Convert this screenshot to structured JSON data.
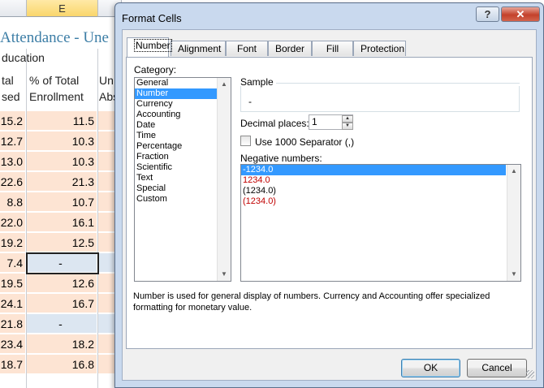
{
  "spreadsheet": {
    "column_letter": "E",
    "title": "Attendance - Une",
    "header_group": "ducation",
    "col_d_header": [
      "tal",
      "sed"
    ],
    "col_e_header": [
      "% of Total",
      "Enrollment"
    ],
    "col_f_header": [
      "Un",
      "Abs"
    ],
    "rows": [
      {
        "d": "15.2",
        "e": "11.5"
      },
      {
        "d": "12.7",
        "e": "10.3"
      },
      {
        "d": "13.0",
        "e": "10.3"
      },
      {
        "d": "22.6",
        "e": "21.3"
      },
      {
        "d": "8.8",
        "e": "10.7"
      },
      {
        "d": "22.0",
        "e": "16.1"
      },
      {
        "d": "19.2",
        "e": "12.5"
      },
      {
        "d": "7.4",
        "e": "-"
      },
      {
        "d": "19.5",
        "e": "12.6"
      },
      {
        "d": "24.1",
        "e": "16.7"
      },
      {
        "d": "21.8",
        "e": "-"
      },
      {
        "d": "23.4",
        "e": "18.2"
      },
      {
        "d": "18.7",
        "e": "16.8"
      }
    ]
  },
  "dialog": {
    "title": "Format Cells",
    "help_glyph": "?",
    "close_glyph": "X",
    "tabs": [
      "Number",
      "Alignment",
      "Font",
      "Border",
      "Fill",
      "Protection"
    ],
    "category_label": "Category:",
    "categories": [
      "General",
      "Number",
      "Currency",
      "Accounting",
      "Date",
      "Time",
      "Percentage",
      "Fraction",
      "Scientific",
      "Text",
      "Special",
      "Custom"
    ],
    "selected_category": "Number",
    "sample_label": "Sample",
    "sample_value": "-",
    "decimal_label": "Decimal places:",
    "decimal_value": "1",
    "separator_label": "Use 1000 Separator (,)",
    "separator_checked": false,
    "negative_label": "Negative numbers:",
    "negative_options": [
      {
        "text": "-1234.0",
        "color": "#ffffff",
        "selected": true
      },
      {
        "text": "1234.0",
        "color": "#c00000",
        "selected": false
      },
      {
        "text": "(1234.0)",
        "color": "#000000",
        "selected": false
      },
      {
        "text": "(1234.0)",
        "color": "#c00000",
        "selected": false
      }
    ],
    "description": "Number is used for general display of numbers.  Currency and Accounting offer specialized formatting for monetary value.",
    "ok_label": "OK",
    "cancel_label": "Cancel"
  }
}
